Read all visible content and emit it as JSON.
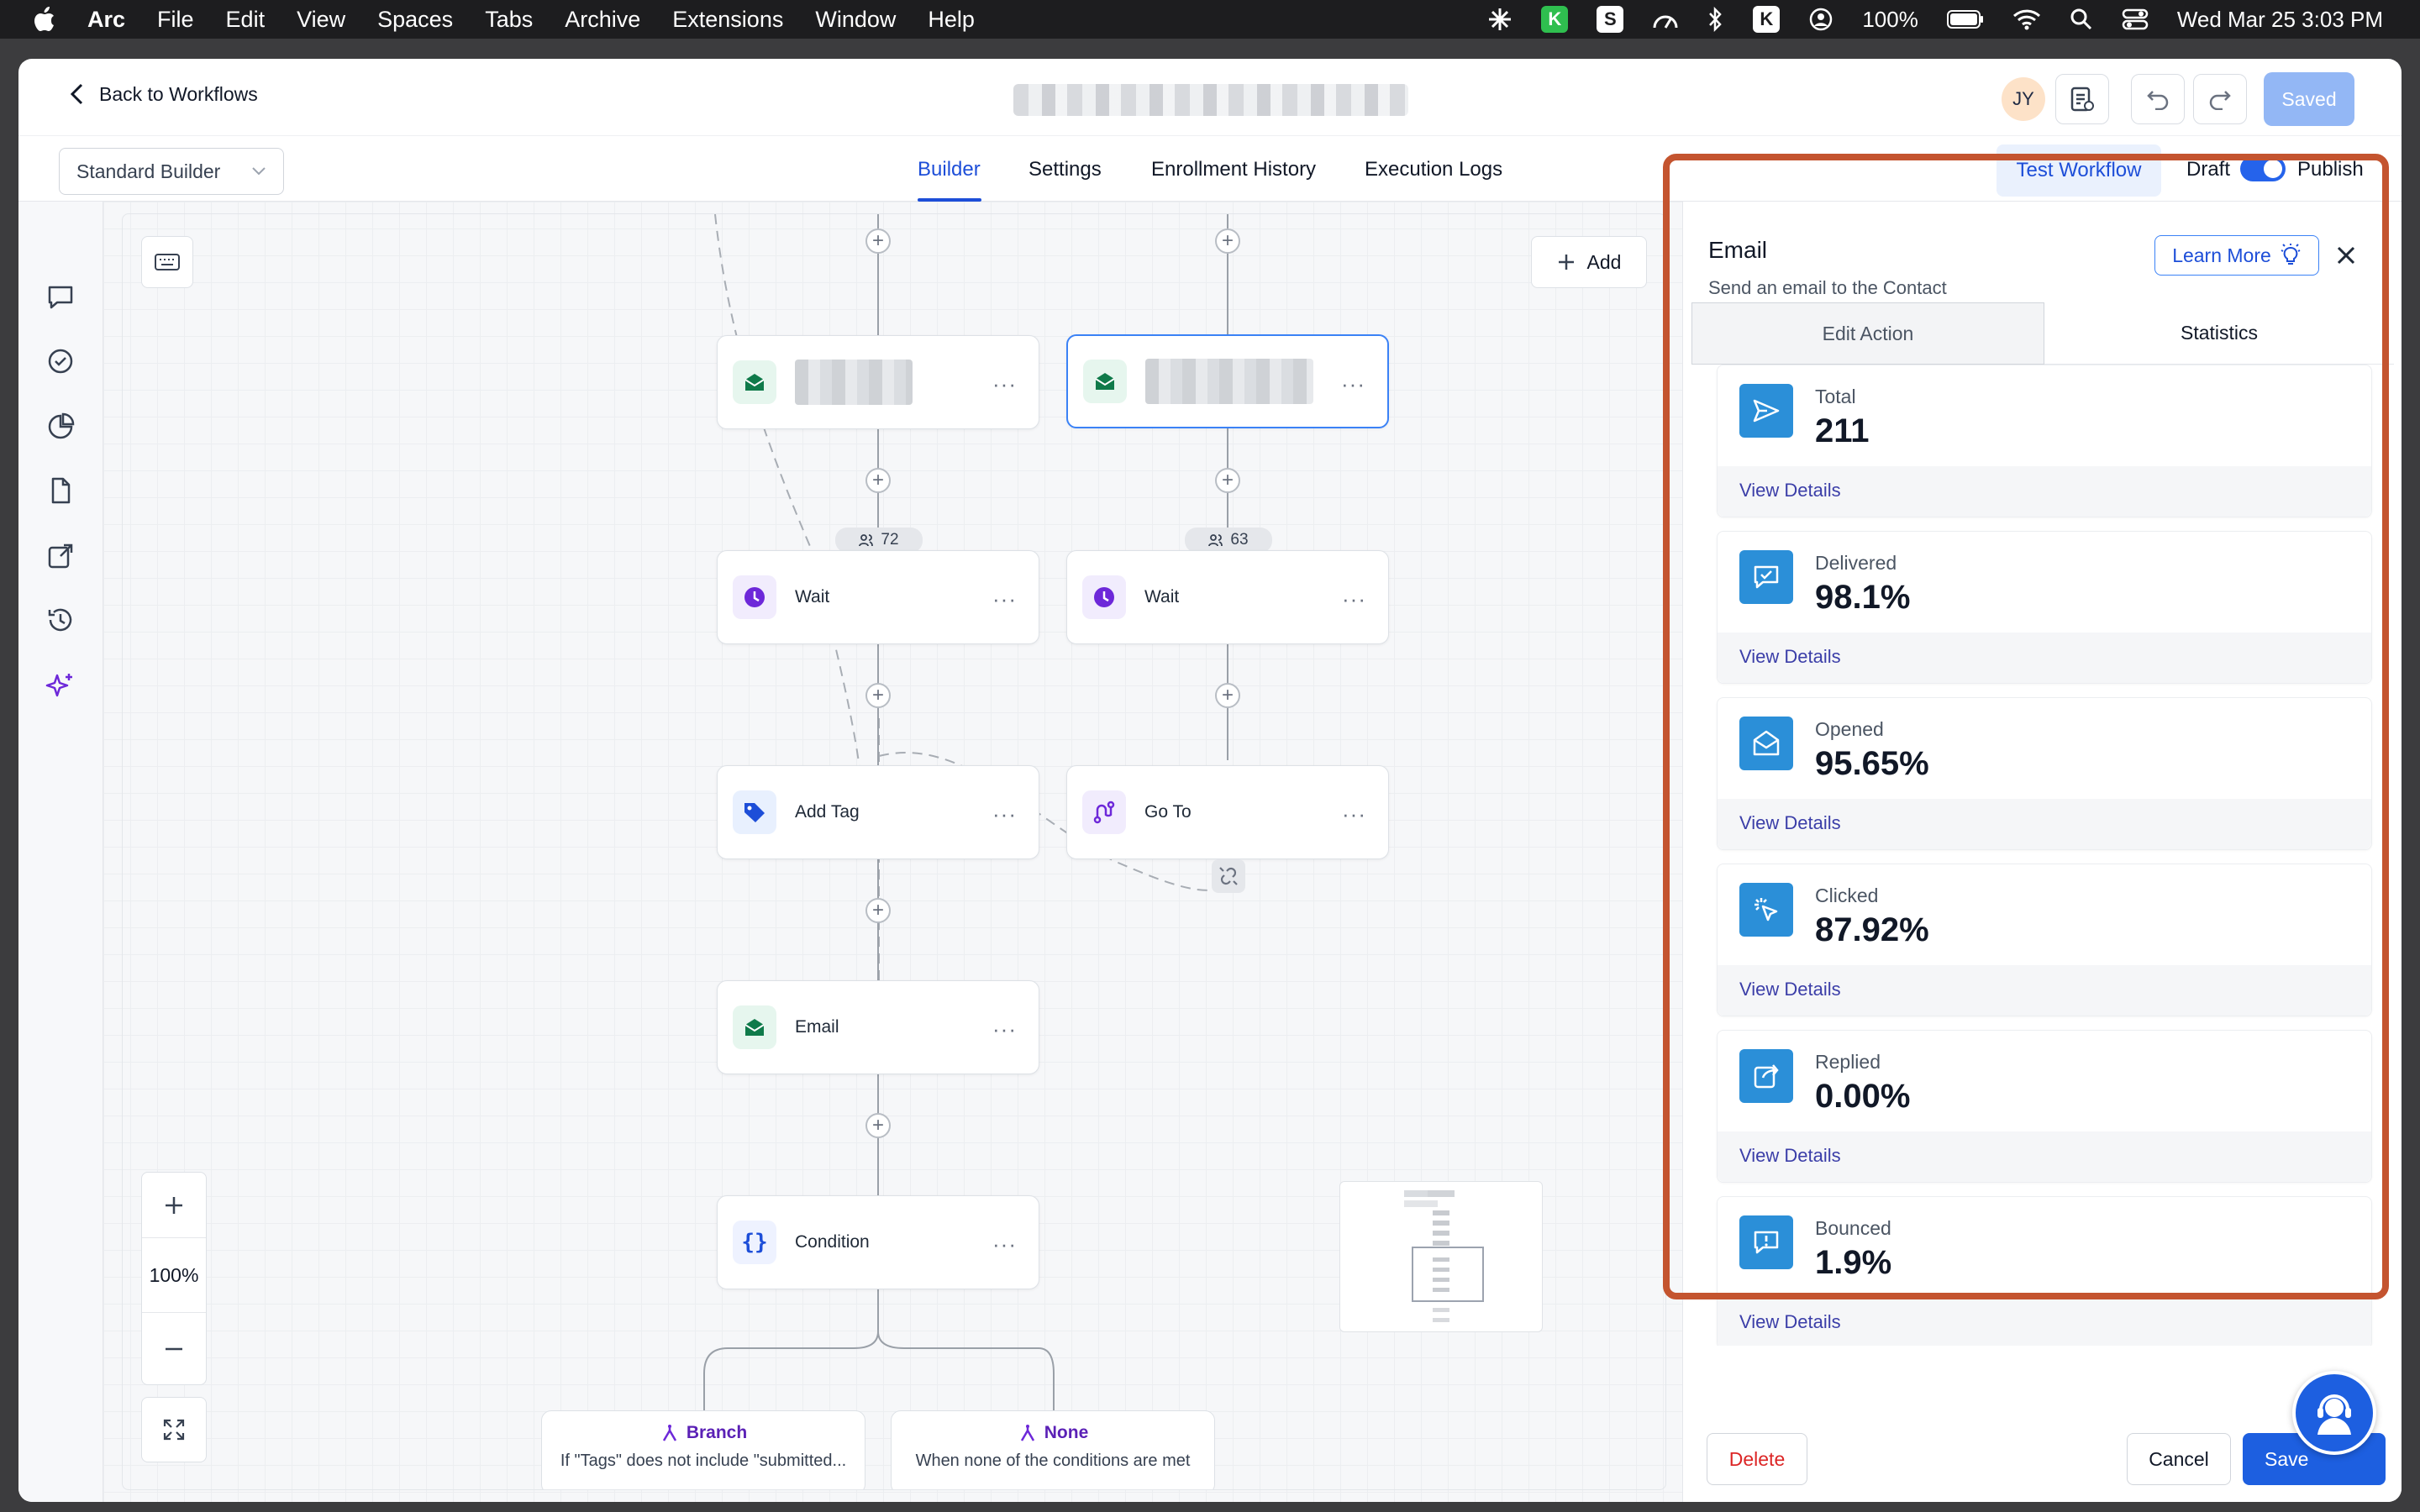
{
  "menubar": {
    "app": "Arc",
    "items": [
      "File",
      "Edit",
      "View",
      "Spaces",
      "Tabs",
      "Archive",
      "Extensions",
      "Window",
      "Help"
    ],
    "battery": "100%",
    "datetime": "Wed Mar 25  3:03 PM"
  },
  "header": {
    "back_label": "Back to Workflows",
    "avatar_initials": "JY",
    "saved_label": "Saved"
  },
  "subbar": {
    "builder_select": "Standard Builder",
    "tabs": [
      "Builder",
      "Settings",
      "Enrollment History",
      "Execution Logs"
    ],
    "active_tab": "Builder",
    "test_label": "Test Workflow",
    "draft_label": "Draft",
    "publish_label": "Publish"
  },
  "canvas": {
    "add_label": "Add",
    "zoom_level": "100%",
    "counts": [
      "72",
      "63"
    ],
    "nodes": {
      "wait_left": "Wait",
      "wait_right": "Wait",
      "add_tag": "Add Tag",
      "go_to": "Go To",
      "email": "Email",
      "condition": "Condition"
    },
    "branches": [
      {
        "title": "Branch",
        "desc": "If \"Tags\" does not include \"submitted..."
      },
      {
        "title": "None",
        "desc": "When none of the conditions are met"
      }
    ]
  },
  "panel": {
    "title": "Email",
    "subtitle": "Send an email to the Contact",
    "learn_more": "Learn More",
    "tabs": [
      "Edit Action",
      "Statistics"
    ],
    "active_tab": "Statistics",
    "stats": [
      {
        "label": "Total",
        "value": "211",
        "link": "View Details",
        "icon": "send-icon"
      },
      {
        "label": "Delivered",
        "value": "98.1%",
        "link": "View Details",
        "icon": "message-check-icon"
      },
      {
        "label": "Opened",
        "value": "95.65%",
        "link": "View Details",
        "icon": "envelope-open-icon"
      },
      {
        "label": "Clicked",
        "value": "87.92%",
        "link": "View Details",
        "icon": "cursor-click-icon"
      },
      {
        "label": "Replied",
        "value": "0.00%",
        "link": "View Details",
        "icon": "reply-share-icon"
      },
      {
        "label": "Bounced",
        "value": "1.9%",
        "link": "View Details",
        "icon": "alert-message-icon"
      }
    ],
    "delete_label": "Delete",
    "cancel_label": "Cancel",
    "save_label": "Save"
  },
  "colors": {
    "accent": "#1d4ed8",
    "stat_icon_bg": "#2b8fd8",
    "highlight_outline": "#c4542f",
    "danger": "#dc2626"
  }
}
